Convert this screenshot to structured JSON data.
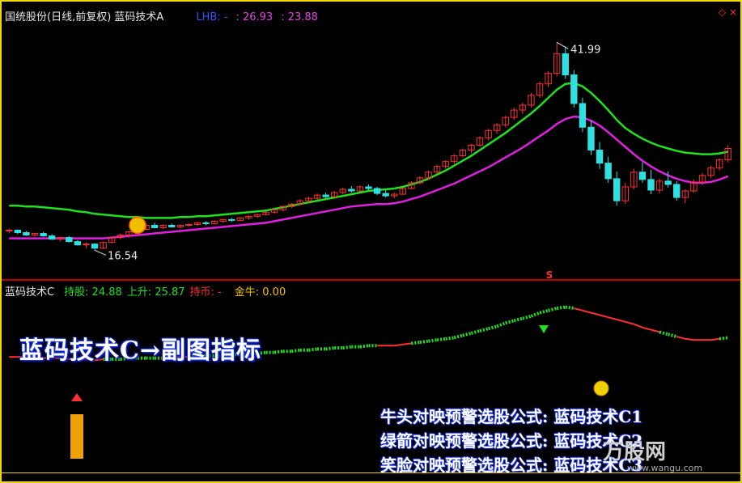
{
  "header": {
    "title": "国统股份(日线,前复权) 蓝码技术A",
    "lhb_label": "LHB: -",
    "value_a": ": 26.93",
    "value_b": ": 23.88"
  },
  "sub_header": {
    "name": "蓝码技术C",
    "hold": "持股: 24.88",
    "rise": "上升: 25.87",
    "coin": "持币: -",
    "gold": "金牛: 0.00"
  },
  "annotations": {
    "high_label": "41.99",
    "low_label": "16.54",
    "signal_s": "S",
    "big_title": "蓝码技术C→副图指标",
    "formula_lines": [
      "牛头对映预警选股公式: 蓝码技术C1",
      "绿箭对映预警选股公式: 蓝码技术C2",
      "笑脸对映预警选股公式: 蓝码技术C3"
    ],
    "logo": "万股网",
    "logo_url": "www.wangu.com"
  },
  "colors": {
    "up": "#ff3030",
    "down": "#30e0e0",
    "green_line": "#20e020",
    "magenta_line": "#e020e0",
    "frame": "#f0d800"
  },
  "chart_data": [
    {
      "type": "candlestick",
      "title": "国统股份(日线,前复权) 蓝码技术A",
      "ylim": [
        14,
        44
      ],
      "candles": [
        [
          18.9,
          19.2,
          18.6,
          19.0
        ],
        [
          19.0,
          19.1,
          18.5,
          18.7
        ],
        [
          18.7,
          18.9,
          18.3,
          18.4
        ],
        [
          18.4,
          18.7,
          18.2,
          18.6
        ],
        [
          18.6,
          18.8,
          18.2,
          18.3
        ],
        [
          18.3,
          18.5,
          17.8,
          17.9
        ],
        [
          17.9,
          18.2,
          17.6,
          18.1
        ],
        [
          18.1,
          18.3,
          17.5,
          17.6
        ],
        [
          17.6,
          17.8,
          17.1,
          17.2
        ],
        [
          17.2,
          17.5,
          16.8,
          17.3
        ],
        [
          17.3,
          17.4,
          16.54,
          16.8
        ],
        [
          16.8,
          17.6,
          16.7,
          17.5
        ],
        [
          17.5,
          18.2,
          17.4,
          18.1
        ],
        [
          18.1,
          18.6,
          17.9,
          18.4
        ],
        [
          18.4,
          18.9,
          18.2,
          18.8
        ],
        [
          18.8,
          19.3,
          18.5,
          19.1
        ],
        [
          19.1,
          19.8,
          19.0,
          19.6
        ],
        [
          19.6,
          19.9,
          19.2,
          19.3
        ],
        [
          19.3,
          19.7,
          19.1,
          19.6
        ],
        [
          19.6,
          19.8,
          19.3,
          19.4
        ],
        [
          19.4,
          19.7,
          19.2,
          19.6
        ],
        [
          19.6,
          19.8,
          19.4,
          19.7
        ],
        [
          19.7,
          20.0,
          19.5,
          19.9
        ],
        [
          19.9,
          20.1,
          19.6,
          19.8
        ],
        [
          19.8,
          20.2,
          19.7,
          20.1
        ],
        [
          20.1,
          20.4,
          19.9,
          20.3
        ],
        [
          20.3,
          20.5,
          20.0,
          20.2
        ],
        [
          20.2,
          20.6,
          20.1,
          20.5
        ],
        [
          20.5,
          20.8,
          20.3,
          20.7
        ],
        [
          20.7,
          21.0,
          20.5,
          20.9
        ],
        [
          20.9,
          21.3,
          20.8,
          21.2
        ],
        [
          21.2,
          21.6,
          21.0,
          21.5
        ],
        [
          21.5,
          22.0,
          21.3,
          21.9
        ],
        [
          21.9,
          22.3,
          21.7,
          22.2
        ],
        [
          22.2,
          22.8,
          22.0,
          22.6
        ],
        [
          22.6,
          23.1,
          22.3,
          22.9
        ],
        [
          22.9,
          23.5,
          22.7,
          23.3
        ],
        [
          23.3,
          23.6,
          22.9,
          23.1
        ],
        [
          23.1,
          23.8,
          23.0,
          23.6
        ],
        [
          23.6,
          24.2,
          23.4,
          24.0
        ],
        [
          24.0,
          24.4,
          23.6,
          23.8
        ],
        [
          23.8,
          24.5,
          23.7,
          24.3
        ],
        [
          24.3,
          24.6,
          23.9,
          24.1
        ],
        [
          24.1,
          24.3,
          23.3,
          23.5
        ],
        [
          23.5,
          23.9,
          23.0,
          23.2
        ],
        [
          23.2,
          23.6,
          22.9,
          23.4
        ],
        [
          23.4,
          24.2,
          23.3,
          24.1
        ],
        [
          24.1,
          25.0,
          24.0,
          24.8
        ],
        [
          24.8,
          25.6,
          24.6,
          25.4
        ],
        [
          25.4,
          26.3,
          25.2,
          26.1
        ],
        [
          26.1,
          27.0,
          25.9,
          26.8
        ],
        [
          26.8,
          27.6,
          26.5,
          27.4
        ],
        [
          27.4,
          28.3,
          27.1,
          28.1
        ],
        [
          28.1,
          29.0,
          27.9,
          28.8
        ],
        [
          28.8,
          29.6,
          28.4,
          29.4
        ],
        [
          29.4,
          30.5,
          29.2,
          30.3
        ],
        [
          30.3,
          31.4,
          30.0,
          31.2
        ],
        [
          31.2,
          32.1,
          30.8,
          31.9
        ],
        [
          31.9,
          33.0,
          31.6,
          32.8
        ],
        [
          32.8,
          34.0,
          32.5,
          33.7
        ],
        [
          33.7,
          34.6,
          33.2,
          34.3
        ],
        [
          34.3,
          35.8,
          34.0,
          35.5
        ],
        [
          35.5,
          37.2,
          35.2,
          36.9
        ],
        [
          36.9,
          38.5,
          36.5,
          38.2
        ],
        [
          38.2,
          41.99,
          37.8,
          40.6
        ],
        [
          40.6,
          41.5,
          37.5,
          38.0
        ],
        [
          38.0,
          38.6,
          34.0,
          34.5
        ],
        [
          34.5,
          35.2,
          31.0,
          31.6
        ],
        [
          31.6,
          32.4,
          28.2,
          28.8
        ],
        [
          28.8,
          29.8,
          26.5,
          27.2
        ],
        [
          27.2,
          28.0,
          24.8,
          25.3
        ],
        [
          25.3,
          26.2,
          22.0,
          22.6
        ],
        [
          22.6,
          24.8,
          22.2,
          24.3
        ],
        [
          24.3,
          26.5,
          24.0,
          26.1
        ],
        [
          26.1,
          27.3,
          24.8,
          25.2
        ],
        [
          25.2,
          26.4,
          23.4,
          23.9
        ],
        [
          23.9,
          25.3,
          23.5,
          25.0
        ],
        [
          25.0,
          26.2,
          24.2,
          24.6
        ],
        [
          24.6,
          25.0,
          22.6,
          23.0
        ],
        [
          23.0,
          24.0,
          22.3,
          23.8
        ],
        [
          23.8,
          25.2,
          23.6,
          24.9
        ],
        [
          24.9,
          26.0,
          24.5,
          25.7
        ],
        [
          25.7,
          26.9,
          25.4,
          26.6
        ],
        [
          26.6,
          27.8,
          26.3,
          27.6
        ],
        [
          27.6,
          29.4,
          27.3,
          29.0
        ]
      ],
      "series": [
        {
          "name": "",
          "values": [
            22.0,
            22.0,
            21.9,
            21.9,
            21.8,
            21.7,
            21.6,
            21.5,
            21.3,
            21.2,
            21.0,
            20.9,
            20.8,
            20.7,
            20.6,
            20.6,
            20.5,
            20.5,
            20.5,
            20.5,
            20.6,
            20.6,
            20.7,
            20.7,
            20.8,
            20.9,
            21.0,
            21.1,
            21.2,
            21.3,
            21.4,
            21.6,
            21.8,
            22.0,
            22.2,
            22.4,
            22.6,
            22.8,
            23.0,
            23.2,
            23.4,
            23.6,
            23.8,
            23.9,
            24.0,
            24.1,
            24.3,
            24.6,
            24.9,
            25.3,
            25.8,
            26.3,
            26.9,
            27.5,
            28.1,
            28.8,
            29.5,
            30.2,
            30.9,
            31.7,
            32.5,
            33.3,
            34.2,
            35.2,
            36.2,
            36.9,
            37.0,
            36.6,
            35.8,
            34.8,
            33.7,
            32.5,
            31.5,
            30.8,
            30.2,
            29.7,
            29.3,
            29.0,
            28.7,
            28.5,
            28.4,
            28.3,
            28.3,
            28.4,
            28.6
          ]
        },
        {
          "name": "",
          "values": [
            18.0,
            18.0,
            18.0,
            18.0,
            18.0,
            18.0,
            18.0,
            18.0,
            18.0,
            18.0,
            18.0,
            18.0,
            18.1,
            18.2,
            18.3,
            18.4,
            18.5,
            18.6,
            18.7,
            18.8,
            18.9,
            19.0,
            19.1,
            19.2,
            19.3,
            19.4,
            19.5,
            19.6,
            19.7,
            19.8,
            19.9,
            20.1,
            20.3,
            20.5,
            20.7,
            20.9,
            21.1,
            21.3,
            21.5,
            21.7,
            21.9,
            22.0,
            22.1,
            22.2,
            22.2,
            22.3,
            22.5,
            22.8,
            23.1,
            23.5,
            23.9,
            24.3,
            24.7,
            25.2,
            25.7,
            26.2,
            26.7,
            27.3,
            27.9,
            28.5,
            29.1,
            29.8,
            30.5,
            31.2,
            32.0,
            32.6,
            32.9,
            32.8,
            32.4,
            31.8,
            31.0,
            30.1,
            29.2,
            28.3,
            27.5,
            26.8,
            26.2,
            25.7,
            25.3,
            25.0,
            24.8,
            24.8,
            24.9,
            25.2,
            25.6
          ]
        }
      ]
    },
    {
      "type": "line",
      "title": "蓝码技术C",
      "ylim": [
        0,
        100
      ],
      "x": [
        0,
        1,
        2,
        3,
        4,
        5,
        6,
        7,
        8,
        9,
        10,
        11,
        12,
        13,
        14,
        15,
        16,
        17,
        18,
        19,
        20,
        21,
        22,
        23,
        24,
        25,
        26,
        27,
        28,
        29,
        30,
        31,
        32,
        33,
        34,
        35,
        36,
        37,
        38,
        39,
        40,
        41,
        42,
        43,
        44,
        45,
        46,
        47,
        48,
        49,
        50,
        51,
        52,
        53,
        54,
        55,
        56,
        57,
        58,
        59,
        60,
        61,
        62,
        63,
        64,
        65,
        66,
        67,
        68,
        69,
        70,
        71,
        72,
        73,
        74,
        75,
        76,
        77,
        78,
        79,
        80,
        81,
        82,
        83,
        84
      ],
      "values": [
        42,
        42,
        42,
        42,
        41,
        41,
        41,
        40,
        40,
        40,
        39,
        40,
        40,
        40,
        41,
        41,
        41,
        41,
        41,
        42,
        42,
        42,
        42,
        43,
        43,
        43,
        44,
        44,
        45,
        45,
        46,
        46,
        47,
        47,
        48,
        48,
        49,
        49,
        50,
        50,
        51,
        51,
        52,
        52,
        52,
        52,
        53,
        54,
        55,
        56,
        57,
        58,
        59,
        61,
        63,
        65,
        67,
        69,
        72,
        74,
        76,
        78,
        81,
        83,
        85,
        86,
        85,
        83,
        81,
        79,
        77,
        75,
        73,
        71,
        68,
        66,
        64,
        62,
        60,
        58,
        57,
        57,
        57,
        58,
        59
      ],
      "signal": [
        "down",
        "down",
        "down",
        "down",
        "down",
        "down",
        "down",
        "down",
        "down",
        "down",
        "down",
        "up",
        "up",
        "up",
        "up",
        "up",
        "up",
        "up",
        "up",
        "down",
        "down",
        "up",
        "up",
        "up",
        "up",
        "up",
        "up",
        "up",
        "up",
        "up",
        "up",
        "up",
        "up",
        "up",
        "up",
        "up",
        "up",
        "up",
        "up",
        "up",
        "up",
        "up",
        "up",
        "down",
        "down",
        "down",
        "down",
        "up",
        "up",
        "up",
        "up",
        "up",
        "up",
        "up",
        "up",
        "up",
        "up",
        "up",
        "up",
        "up",
        "up",
        "up",
        "up",
        "up",
        "up",
        "up",
        "down",
        "down",
        "down",
        "down",
        "down",
        "down",
        "down",
        "down",
        "down",
        "down",
        "up",
        "up",
        "down",
        "down",
        "down",
        "down",
        "down",
        "up",
        "up"
      ]
    }
  ]
}
